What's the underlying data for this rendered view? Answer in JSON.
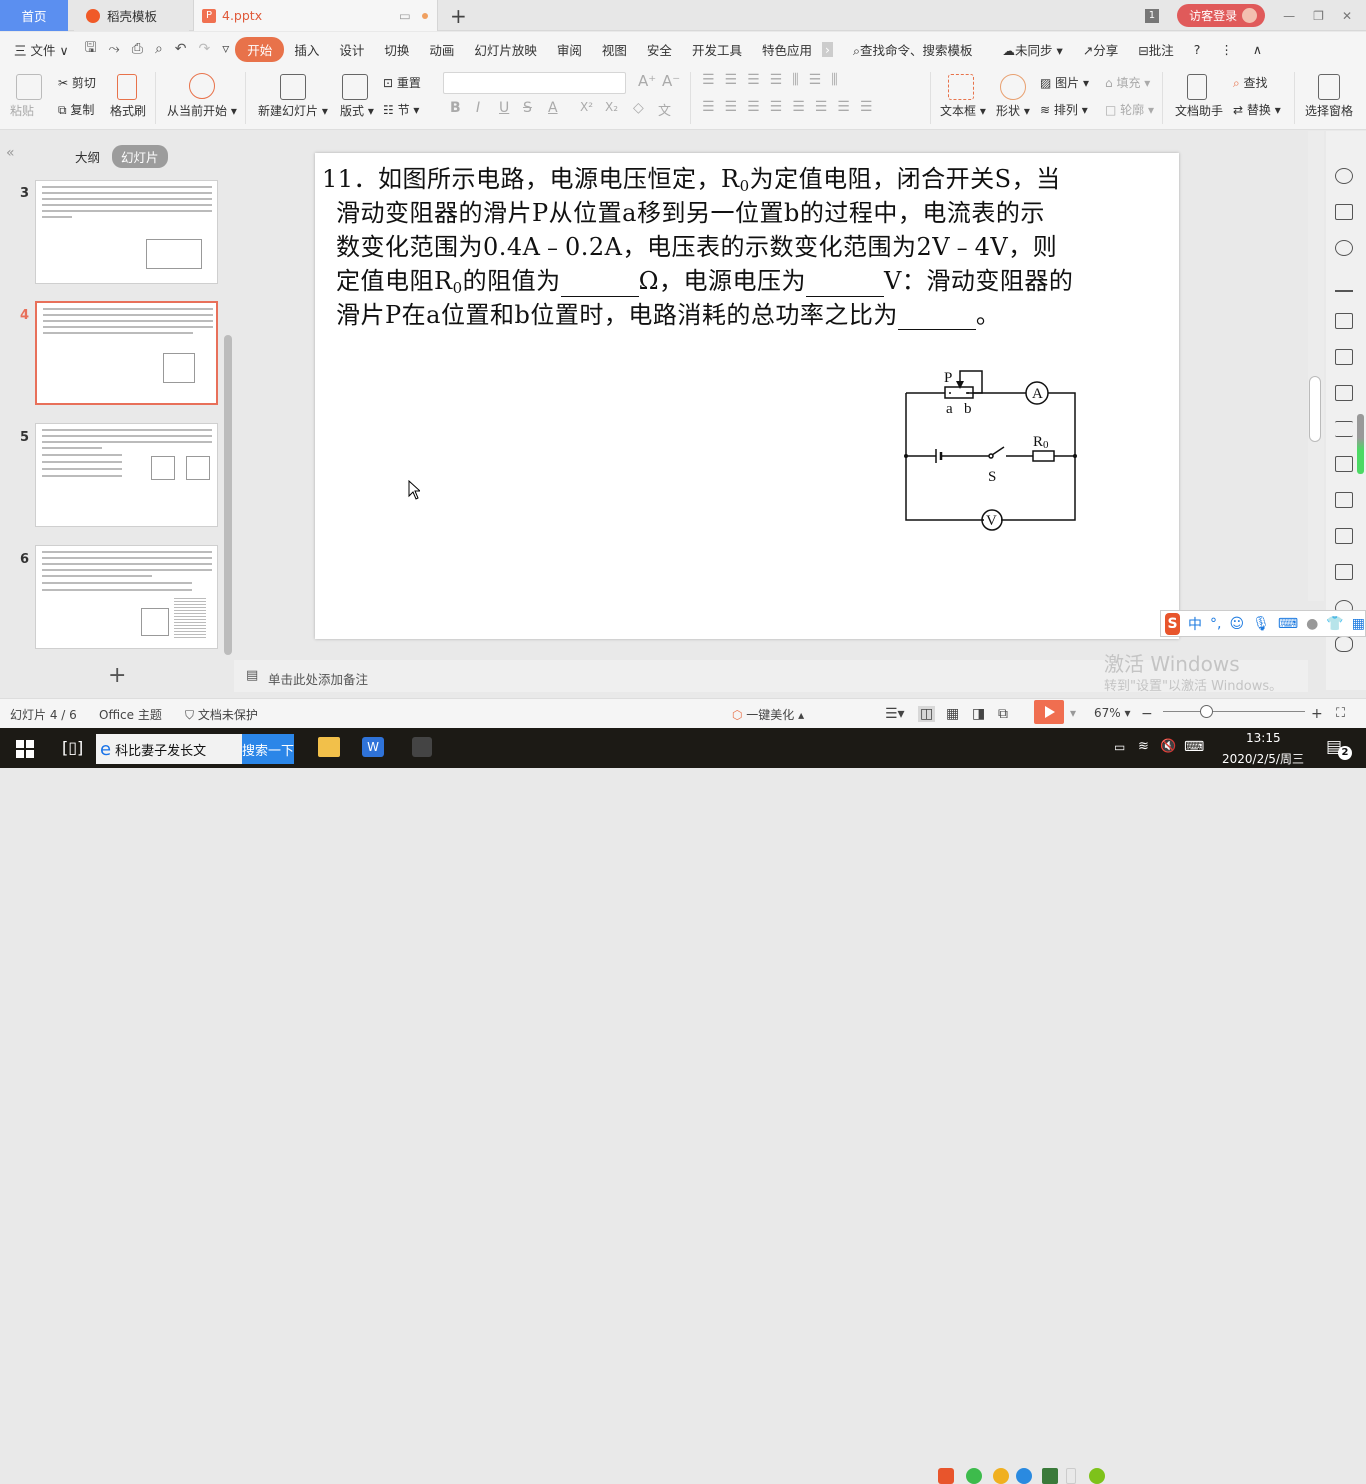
{
  "tabs": {
    "home": "首页",
    "template": "稻壳模板",
    "file": "4.pptx",
    "file_icon": "P",
    "new_tab": "+"
  },
  "window": {
    "badge": "1",
    "login": "访客登录",
    "minimize": "—",
    "restore": "❐",
    "close": "✕"
  },
  "menu": {
    "file": "三 文件 ∨",
    "items": [
      "开始",
      "插入",
      "设计",
      "切换",
      "动画",
      "幻灯片放映",
      "审阅",
      "视图",
      "安全",
      "开发工具",
      "特色应用"
    ],
    "more": "›",
    "search": "查找命令、搜索模板",
    "sync": "未同步",
    "share": "分享",
    "comment": "批注",
    "help": "?",
    "kebab": "⋮",
    "collapse": "∧"
  },
  "ribbon": {
    "paste": "粘贴",
    "cut": "剪切",
    "copy": "复制",
    "format_painter": "格式刷",
    "from_current": "从当前开始",
    "new_slide": "新建幻灯片",
    "layout": "版式",
    "reset": "重置",
    "section": "节",
    "bold": "B",
    "italic": "I",
    "underline": "U",
    "strike": "S",
    "font_color": "A",
    "superscript": "X²",
    "subscript": "X₂",
    "phonetic": "文",
    "grow": "A⁺",
    "shrink": "A⁻",
    "textbox": "文本框",
    "shape": "形状",
    "picture": "图片",
    "fill": "填充",
    "arrange": "排列",
    "outline": "轮廓",
    "doc_assist": "文档助手",
    "find": "查找",
    "replace": "替换",
    "select_pane": "选择窗格"
  },
  "left_panel": {
    "collapse": "«",
    "outline_tab": "大纲",
    "slides_tab": "幻灯片",
    "thumbnails": [
      {
        "num": "3",
        "selected": false
      },
      {
        "num": "4",
        "selected": true
      },
      {
        "num": "5",
        "selected": false
      },
      {
        "num": "6",
        "selected": false
      }
    ],
    "add": "+"
  },
  "slide": {
    "lines": [
      "11．如图所示电路，电源电压恒定，R",
      "为定值电阻，闭合开关S，当",
      "滑动变阻器的滑片P从位置a移到另一位置b的过程中，电流表的示",
      "数变化范围为0.4A﹣0.2A，电压表的示数变化范围为2V﹣4V，则",
      "定值电阻R",
      "的阻值为",
      "Ω，电源电压为",
      "V：滑动变阻器的",
      "滑片P在a位置和b位置时，电路消耗的总功率之比为",
      "。"
    ],
    "sub0": "0",
    "circuit": {
      "P": "P",
      "a": "a",
      "b": "b",
      "A": "A",
      "R0": "R",
      "R0sub": "0",
      "S": "S",
      "V": "V"
    }
  },
  "notes": {
    "placeholder": "单击此处添加备注"
  },
  "ime": {
    "logo": "S",
    "mode": "中",
    "punct": "°,"
  },
  "watermark": {
    "line1": "激活 Windows",
    "line2": "转到\"设置\"以激活 Windows。"
  },
  "status": {
    "slide_pos": "幻灯片 4 / 6",
    "theme": "Office 主题",
    "protect": "文档未保护",
    "beautify": "一键美化",
    "zoom": "67%",
    "zoom_level_percent": 67
  },
  "taskbar": {
    "search_value": "科比妻子发长文",
    "search_button": "搜索一下",
    "time": "13:15",
    "date": "2020/2/5/周三",
    "notif_count": "2"
  }
}
